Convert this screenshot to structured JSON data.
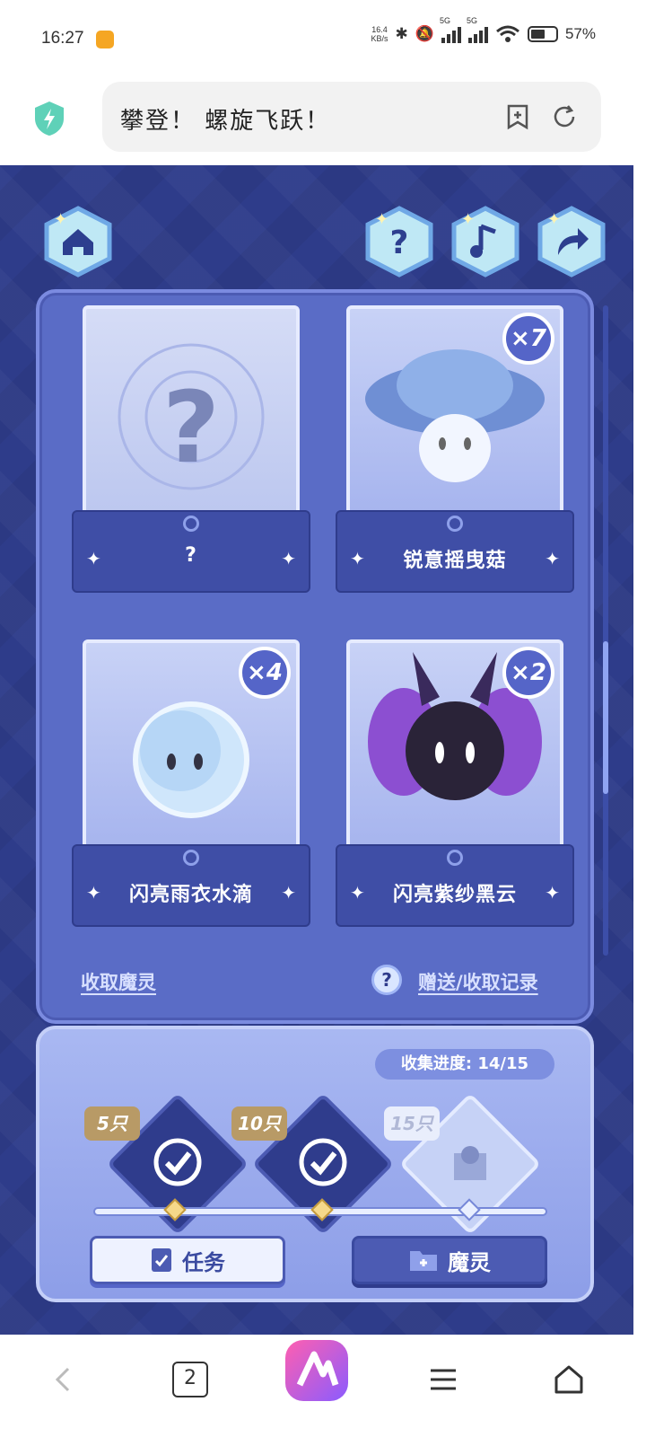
{
  "status_bar": {
    "time": "16:27",
    "speed_value": "16.4",
    "speed_unit": "KB/s",
    "network_label_1": "5G",
    "network_label_2": "5G",
    "battery": "57%"
  },
  "browser": {
    "page_title": "攀登！ 螺旋飞跃！",
    "tab_count": "2"
  },
  "cards": [
    {
      "name": "?",
      "count": ""
    },
    {
      "name": "锐意摇曳菇",
      "count": "×7"
    },
    {
      "name": "闪亮雨衣水滴",
      "count": "×4"
    },
    {
      "name": "闪亮紫纱黑云",
      "count": "×2"
    }
  ],
  "links": {
    "receive": "收取魔灵",
    "help": "?",
    "history": "赠送/收取记录"
  },
  "collection": {
    "progress_label": "收集进度: 14/15",
    "progress_value": 0.93,
    "milestones": [
      {
        "label": "5只",
        "claimed": true
      },
      {
        "label": "10只",
        "claimed": true
      },
      {
        "label": "15只",
        "claimed": false
      }
    ]
  },
  "buttons": {
    "task": "任务",
    "spirit": "魔灵"
  },
  "colors": {
    "game_bg": "#2e3c8a",
    "panel": "#5a6cc6",
    "accent": "#4c5bb3"
  },
  "icons": [
    "home-icon",
    "help-icon",
    "music-icon",
    "share-icon",
    "shield-icon",
    "bookmark-add-icon",
    "refresh-icon",
    "back-icon",
    "tabs-icon",
    "app-logo-icon",
    "menu-icon",
    "home-nav-icon"
  ]
}
